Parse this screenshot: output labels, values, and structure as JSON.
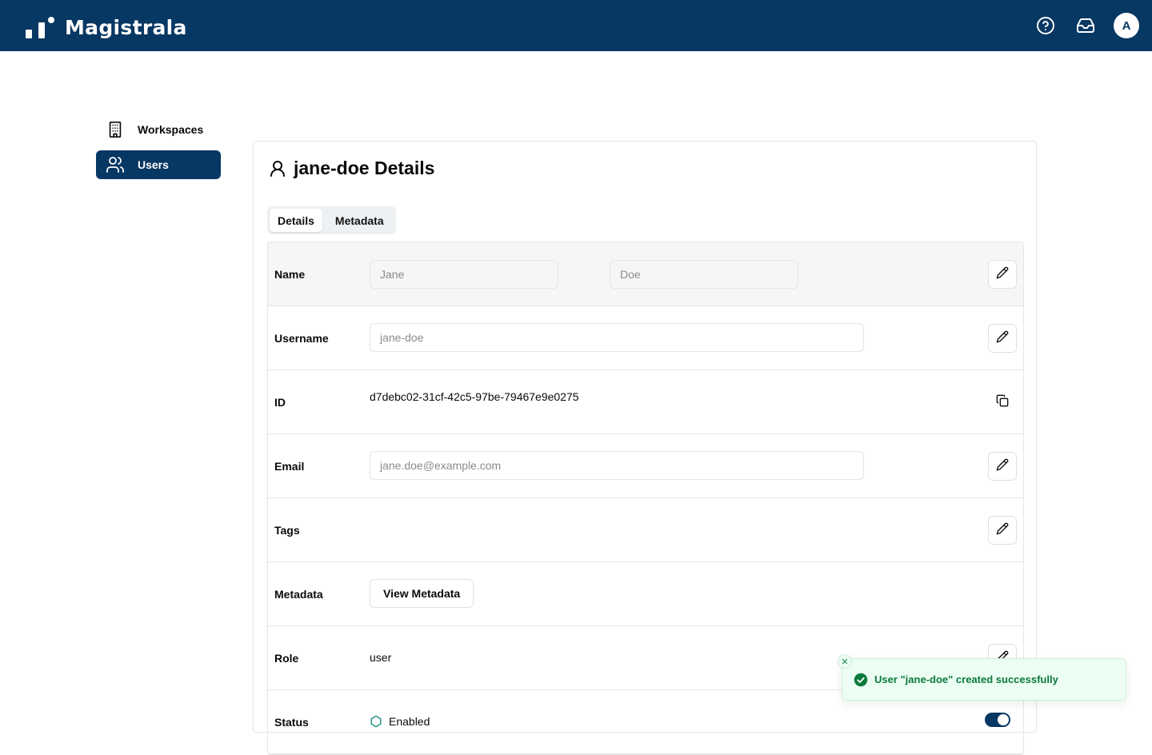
{
  "app": {
    "name": "Magistrala",
    "header_icons": [
      "help-circle-icon",
      "inbox-icon"
    ],
    "avatar_initial": "A",
    "brand_color": "#073763"
  },
  "sidebar": {
    "items": [
      {
        "label": "Workspaces",
        "icon": "building-icon",
        "active": false
      },
      {
        "label": "Users",
        "icon": "users-icon",
        "active": true
      }
    ]
  },
  "page": {
    "title": "jane-doe Details",
    "title_icon": "user-icon"
  },
  "tabs": [
    {
      "label": "Details",
      "active": true
    },
    {
      "label": "Metadata",
      "active": false
    }
  ],
  "fields": {
    "name": {
      "label": "Name",
      "first_placeholder": "Jane",
      "last_placeholder": "Doe"
    },
    "username": {
      "label": "Username",
      "placeholder": "jane-doe"
    },
    "id": {
      "label": "ID",
      "value": "d7debc02-31cf-42c5-97be-79467e9e0275"
    },
    "email": {
      "label": "Email",
      "placeholder": "jane.doe@example.com"
    },
    "tags": {
      "label": "Tags"
    },
    "metadata": {
      "label": "Metadata",
      "button": "View Metadata"
    },
    "role": {
      "label": "Role",
      "value": "user"
    },
    "status": {
      "label": "Status",
      "value": "Enabled",
      "enabled": true
    }
  },
  "toast": {
    "message": "User \"jane-doe\" created successfully",
    "type": "success",
    "color": "#0b7a3b"
  }
}
